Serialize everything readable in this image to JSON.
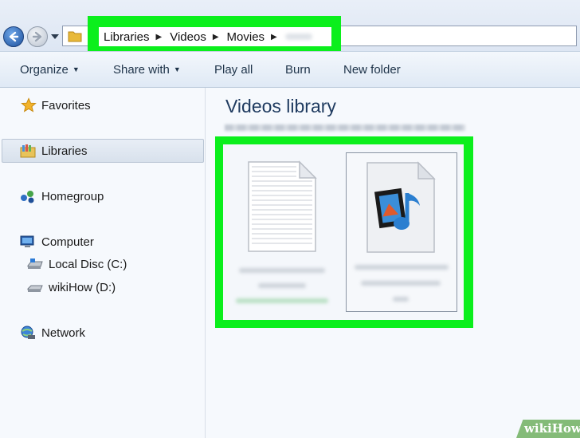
{
  "address_bar": {
    "breadcrumbs": [
      "Libraries",
      "Videos",
      "Movies"
    ],
    "separator": "▶",
    "highlight_color": "#0bef1c"
  },
  "toolbar": {
    "organize_label": "Organize",
    "share_with_label": "Share with",
    "play_all_label": "Play all",
    "burn_label": "Burn",
    "new_folder_label": "New folder",
    "caret": "▼"
  },
  "sidebar": {
    "favorites": "Favorites",
    "libraries": "Libraries",
    "homegroup": "Homegroup",
    "computer": "Computer",
    "local_disc": "Local Disc (C:)",
    "wikihow_drive": "wikiHow (D:)",
    "network": "Network"
  },
  "main": {
    "title": "Videos library",
    "files": [
      {
        "icon": "text-document-icon",
        "selected": false
      },
      {
        "icon": "media-file-icon",
        "selected": true
      }
    ]
  },
  "watermark": {
    "brand": "wikiHow",
    "prefix": "wiki",
    "suffix": "How"
  }
}
